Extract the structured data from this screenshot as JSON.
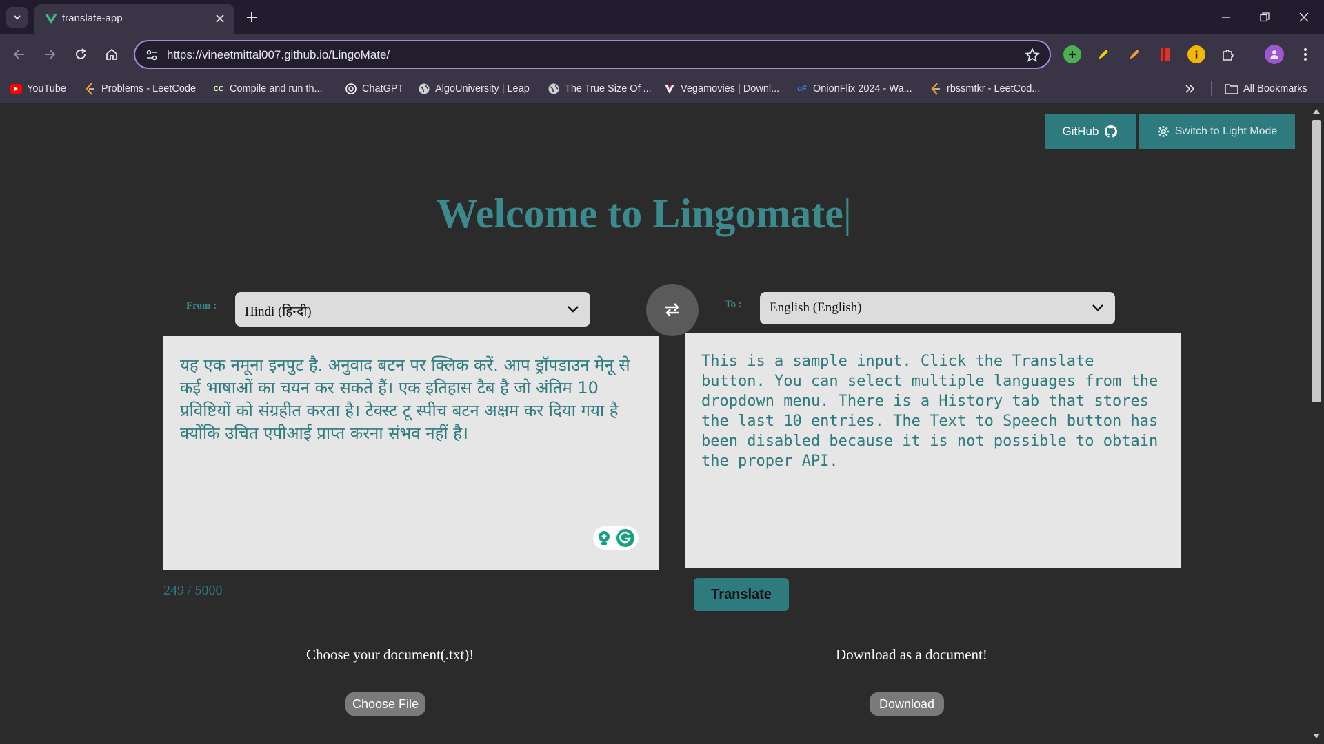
{
  "browser": {
    "tab_title": "translate-app",
    "url": "https://vineetmittal007.github.io/LingoMate/",
    "accent_color": "#9d8fd6",
    "bookmarks": [
      {
        "label": "YouTube",
        "icon": "youtube-icon",
        "color": "#ff0000"
      },
      {
        "label": "Problems - LeetCode",
        "icon": "leetcode-icon",
        "color": "#f89f1b"
      },
      {
        "label": "Compile and run th...",
        "icon": "cc-icon",
        "color": "#ffffff"
      },
      {
        "label": "ChatGPT",
        "icon": "chatgpt-icon",
        "color": "#ffffff"
      },
      {
        "label": "AlgoUniversity | Leap",
        "icon": "globe-icon",
        "color": "#ffffff"
      },
      {
        "label": "The True Size Of ...",
        "icon": "globe-icon",
        "color": "#ffffff"
      },
      {
        "label": "Vegamovies | Downl...",
        "icon": "v-icon",
        "color": "#ffffff"
      },
      {
        "label": "OnionFlix 2024 - Wa...",
        "icon": "of-icon",
        "color": "#2f80ed"
      },
      {
        "label": "rbssmtkr - LeetCod...",
        "icon": "leetcode-icon",
        "color": "#f89f1b"
      }
    ],
    "all_bookmarks_label": "All Bookmarks"
  },
  "header": {
    "github_label": "GitHub",
    "mode_label": "Switch to Light Mode"
  },
  "headline": "Welcome to Lingomate",
  "headline_cursor": "|",
  "from": {
    "label": "From :",
    "selected": "Hindi (हिन्दी)"
  },
  "to": {
    "label": "To :",
    "selected": "English (English)"
  },
  "source_text": "यह एक नमूना इनपुट है. अनुवाद बटन पर क्लिक करें. आप ड्रॉपडाउन मेनू से कई भाषाओं का चयन कर सकते हैं। एक इतिहास टैब है जो अंतिम 10 प्रविष्टियों को संग्रहीत करता है। टेक्स्ट टू स्पीच बटन अक्षम कर दिया गया है क्योंकि उचित एपीआई प्राप्त करना संभव नहीं है।",
  "translated_text": "This is a sample input. Click the Translate button. You can select multiple languages from the dropdown menu. There is a History tab that stores the last 10 entries. The Text to Speech button has been disabled because it is not possible to obtain the proper API.",
  "char_count": "249 / 5000",
  "translate_label": "Translate",
  "upload": {
    "label": "Choose your document(.txt)!",
    "button": "Choose File"
  },
  "download": {
    "label": "Download as a document!",
    "button": "Download"
  },
  "colors": {
    "teal": "#2d7a7f",
    "background": "#2b2b2b"
  }
}
